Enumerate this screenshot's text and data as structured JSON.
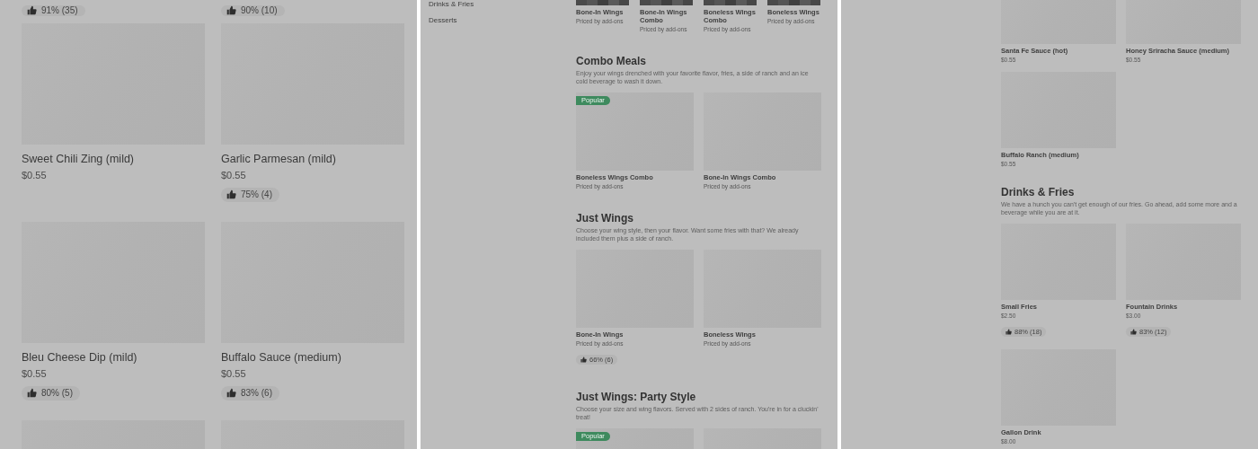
{
  "left_panel": {
    "top_ratings": [
      "91% (35)",
      "90% (10)"
    ],
    "items": [
      {
        "kind": "placeholder",
        "name": "Sweet Chili Zing (mild)",
        "price": "$0.55"
      },
      {
        "kind": "placeholder",
        "name": "Garlic Parmesan (mild)",
        "price": "$0.55",
        "rating": "75% (4)"
      },
      {
        "kind": "placeholder",
        "name": "Bleu Cheese Dip (mild)",
        "price": "$0.55",
        "rating": "80% (5)"
      },
      {
        "kind": "placeholder",
        "name": "Buffalo Sauce (medium)",
        "price": "$0.55",
        "rating": "83% (6)"
      },
      {
        "kind": "placeholder"
      },
      {
        "kind": "placeholder"
      }
    ]
  },
  "middle_panel": {
    "sidebar": {
      "items": [
        {
          "label": "Drinks & Fries"
        },
        {
          "label": "Desserts"
        }
      ]
    },
    "top_items": [
      {
        "name": "Bone-In Wings",
        "price": "Priced by add-ons"
      },
      {
        "name": "Bone-In Wings Combo",
        "price": "Priced by add-ons"
      },
      {
        "name": "Boneless Wings Combo",
        "price": "Priced by add-ons"
      },
      {
        "name": "Boneless Wings",
        "price": "Priced by add-ons"
      }
    ],
    "sections": [
      {
        "title": "Combo Meals",
        "description": "Enjoy your wings drenched with your favorite flavor, fries, a side of ranch and an ice cold beverage to wash it down.",
        "items": [
          {
            "kind": "placeholder",
            "name": "Boneless Wings Combo",
            "price": "Priced by add-ons",
            "badge": "Popular"
          },
          {
            "kind": "placeholder",
            "name": "Bone-In Wings Combo",
            "price": "Priced by add-ons"
          }
        ]
      },
      {
        "title": "Just Wings",
        "description": "Choose your wing style, then your flavor. Want some fries with that? We already included them plus a side of ranch.",
        "items": [
          {
            "kind": "placeholder",
            "name": "Bone-In Wings",
            "price": "Priced by add-ons",
            "rating": "66% (6)"
          },
          {
            "kind": "placeholder",
            "name": "Boneless Wings",
            "price": "Priced by add-ons"
          }
        ]
      },
      {
        "title": "Just Wings: Party Style",
        "description": "Choose your size and wing flavors. Served with 2 sides of ranch. You're in for a cluckin' treat!",
        "items": [
          {
            "kind": "placeholder",
            "badge": "Popular"
          },
          {
            "kind": "placeholder"
          }
        ]
      }
    ]
  },
  "right_panel": {
    "items": [
      {
        "kind": "placeholder",
        "name": "Santa Fe Sauce (hot)",
        "price": "$0.55"
      },
      {
        "kind": "placeholder",
        "name": "Honey Sriracha Sauce (medium)",
        "price": "$0.55"
      },
      {
        "kind": "placeholder",
        "name": "Buffalo Ranch (medium)",
        "price": "$0.55"
      }
    ],
    "sections": [
      {
        "title": "Drinks & Fries",
        "description": "We have a hunch you can't get enough of our fries. Go ahead, add some more and a beverage while you are at it.",
        "items": [
          {
            "kind": "placeholder",
            "name": "Small Fries",
            "price": "$2.50",
            "rating": "88% (18)"
          },
          {
            "kind": "placeholder",
            "name": "Fountain Drinks",
            "price": "$3.00",
            "rating": "83% (12)"
          },
          {
            "kind": "placeholder",
            "name": "Gallon Drink",
            "price": "$8.00"
          }
        ]
      }
    ]
  }
}
